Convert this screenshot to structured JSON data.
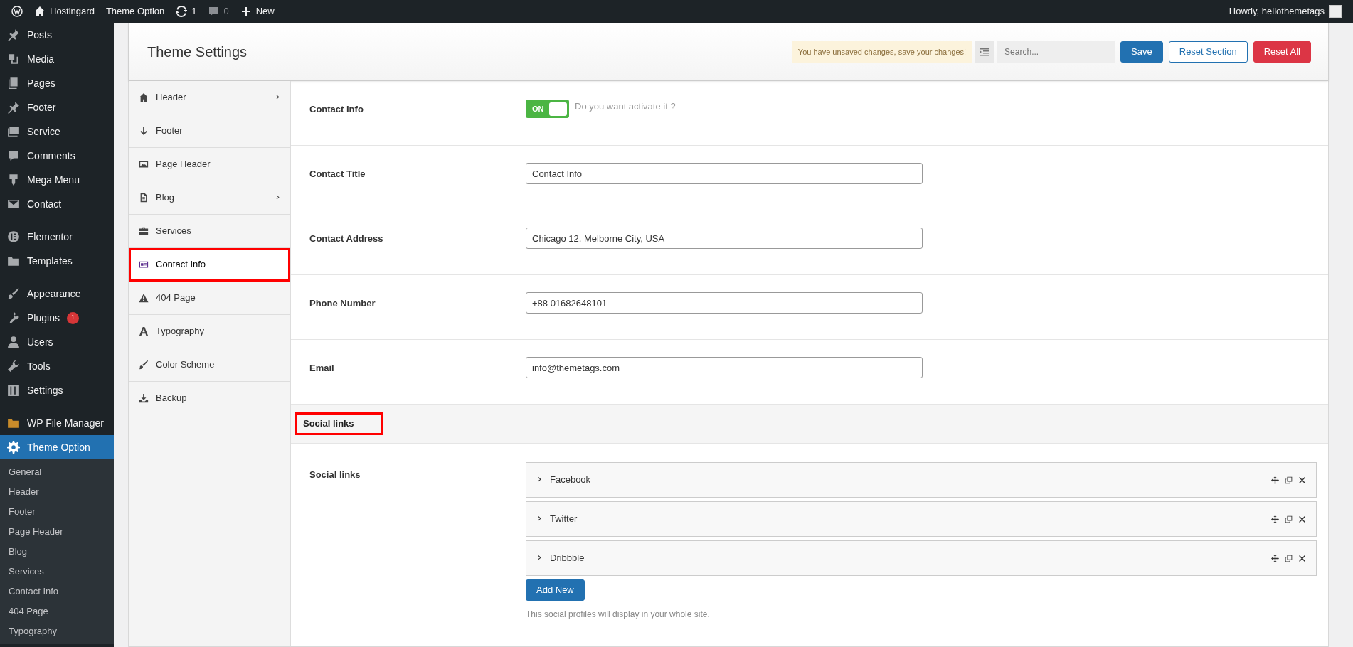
{
  "admin_bar": {
    "site": "Hostingard",
    "page": "Theme Option",
    "updates": "1",
    "comments": "0",
    "new": "New",
    "greeting": "Howdy, hellothemetags"
  },
  "sidebar": {
    "items": [
      {
        "label": "Posts",
        "selected": false
      },
      {
        "label": "Media",
        "selected": false
      },
      {
        "label": "Pages",
        "selected": false
      },
      {
        "label": "Footer",
        "selected": false
      },
      {
        "label": "Service",
        "selected": false
      },
      {
        "label": "Comments",
        "selected": false
      },
      {
        "label": "Mega Menu",
        "selected": false
      },
      {
        "label": "Contact",
        "selected": false,
        "separator_after": true
      },
      {
        "label": "Elementor",
        "selected": false
      },
      {
        "label": "Templates",
        "selected": false,
        "separator_after": true
      },
      {
        "label": "Appearance",
        "selected": false
      },
      {
        "label": "Plugins",
        "selected": false,
        "badge": "1"
      },
      {
        "label": "Users",
        "selected": false
      },
      {
        "label": "Tools",
        "selected": false
      },
      {
        "label": "Settings",
        "selected": false,
        "separator_after": true
      },
      {
        "label": "WP File Manager",
        "selected": false
      },
      {
        "label": "Theme Option",
        "selected": true
      }
    ],
    "submenu": [
      "General",
      "Header",
      "Footer",
      "Page Header",
      "Blog",
      "Services",
      "Contact Info",
      "404 Page",
      "Typography"
    ]
  },
  "panel": {
    "title": "Theme Settings",
    "notice": "You have unsaved changes, save your changes!",
    "search": {
      "placeholder": "Search..."
    },
    "buttons": [
      {
        "label": "Save",
        "kind": "primary"
      },
      {
        "label": "Reset Section",
        "kind": "outline"
      },
      {
        "label": "Reset All",
        "kind": "danger"
      }
    ]
  },
  "nav": [
    {
      "label": "Header",
      "has_children": true,
      "selected": false,
      "highlighted": false
    },
    {
      "label": "Footer",
      "has_children": false,
      "selected": false,
      "highlighted": false
    },
    {
      "label": "Page Header",
      "has_children": false,
      "selected": false,
      "highlighted": false
    },
    {
      "label": "Blog",
      "has_children": true,
      "selected": false,
      "highlighted": false
    },
    {
      "label": "Services",
      "has_children": false,
      "selected": false,
      "highlighted": false
    },
    {
      "label": "Contact Info",
      "has_children": false,
      "selected": true,
      "highlighted": true
    },
    {
      "label": "404 Page",
      "has_children": false,
      "selected": false,
      "highlighted": false
    },
    {
      "label": "Typography",
      "has_children": false,
      "selected": false,
      "highlighted": false
    },
    {
      "label": "Color Scheme",
      "has_children": false,
      "selected": false,
      "highlighted": false
    },
    {
      "label": "Backup",
      "has_children": false,
      "selected": false,
      "highlighted": false
    }
  ],
  "fields": [
    {
      "kind": "switch",
      "label": "Contact Info",
      "on": true,
      "switch_text": "ON",
      "hint": "Do you want activate it ?"
    },
    {
      "kind": "text",
      "label": "Contact Title",
      "value": "Contact Info"
    },
    {
      "kind": "text",
      "label": "Contact Address",
      "value": "Chicago 12, Melborne City, USA"
    },
    {
      "kind": "text",
      "label": "Phone Number",
      "value": "+88 01682648101"
    },
    {
      "kind": "text",
      "label": "Email",
      "value": "info@themetags.com"
    }
  ],
  "section": {
    "title": "Social links",
    "highlighted": true
  },
  "social": {
    "label": "Social links",
    "items": [
      {
        "title": "Facebook"
      },
      {
        "title": "Twitter"
      },
      {
        "title": "Dribbble"
      }
    ],
    "add_button": "Add New",
    "help": "This social profiles will display in your whole site."
  }
}
